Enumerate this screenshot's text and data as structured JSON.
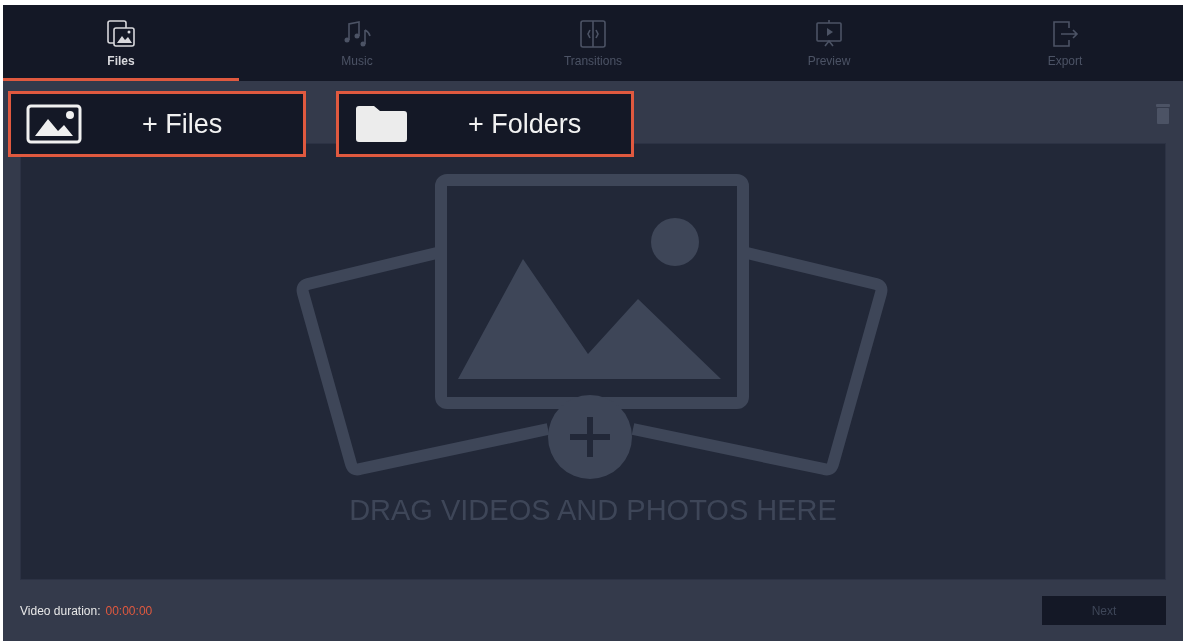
{
  "tabs": [
    {
      "kind": "files",
      "label": "Files",
      "selected": true
    },
    {
      "kind": "music",
      "label": "Music",
      "selected": false
    },
    {
      "kind": "transitions",
      "label": "Transitions",
      "selected": false
    },
    {
      "kind": "preview",
      "label": "Preview",
      "selected": false
    },
    {
      "kind": "export",
      "label": "Export",
      "selected": false
    }
  ],
  "add_buttons": [
    {
      "kind": "files",
      "label": "+ Files"
    },
    {
      "kind": "folders",
      "label": "+ Folders"
    }
  ],
  "drop_zone": {
    "hint": "DRAG VIDEOS AND PHOTOS HERE"
  },
  "footer": {
    "label": "Video duration:",
    "value": "00:00:00",
    "next_button": "Next"
  }
}
